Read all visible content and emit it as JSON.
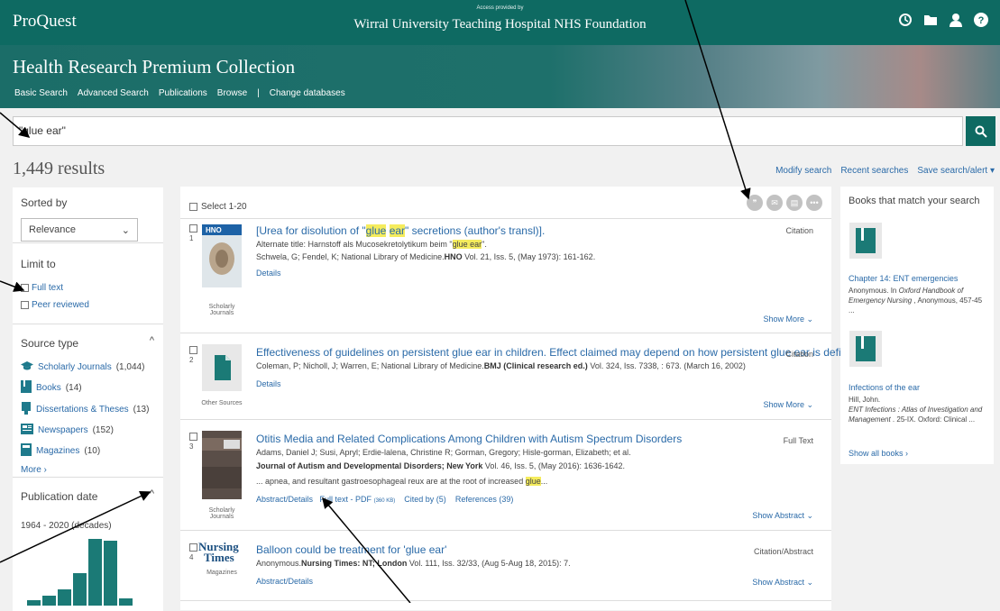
{
  "header": {
    "logo": "ProQuest",
    "access_label": "Access provided by",
    "access_org": "Wirral University Teaching Hospital NHS Foundation",
    "icons": [
      "history-icon",
      "folder-icon",
      "user-icon",
      "help-icon"
    ]
  },
  "banner": {
    "collection_title": "Health Research Premium Collection",
    "nav": [
      "Basic Search",
      "Advanced Search",
      "Publications",
      "Browse",
      "|",
      "Change databases"
    ]
  },
  "search": {
    "value": "\"glue ear\"",
    "button_icon": "search-icon"
  },
  "results_summary": {
    "count": "1,449 results",
    "links": [
      "Modify search",
      "Recent searches",
      "Save search/alert ▾"
    ]
  },
  "sidebar": {
    "sorted_by": "Sorted by",
    "sort_value": "Relevance",
    "limit_to": "Limit to",
    "limits": [
      "Full text",
      "Peer reviewed"
    ],
    "source_type": "Source type",
    "sources": [
      {
        "label": "Scholarly Journals",
        "count": "(1,044)"
      },
      {
        "label": "Books",
        "count": "(14)"
      },
      {
        "label": "Dissertations & Theses",
        "count": "(13)"
      },
      {
        "label": "Newspapers",
        "count": "(152)"
      },
      {
        "label": "Magazines",
        "count": "(10)"
      }
    ],
    "more": "More ›",
    "pub_date": "Publication date",
    "pub_range": "1964 - 2020 (decades)",
    "histogram": [
      0.08,
      0.14,
      0.24,
      0.47,
      0.98,
      0.95,
      0.1
    ]
  },
  "toolbar": {
    "select_all": "Select 1-20",
    "tools": [
      "cite-icon",
      "email-icon",
      "print-icon",
      "more-icon"
    ]
  },
  "records": [
    {
      "num": "1",
      "title_a": "[Urea for disolution of \"",
      "hl1": "glue",
      "hl2": "ear",
      "title_b": "\" secretions (author's transl)].",
      "alt_a": "Alternate title: Harnstoff als Mucosekretolytikum beim \"",
      "alt_hl": "glue ear",
      "alt_b": "\".",
      "authors": "Schwela, G; Fendel, K; National Library of Medicine.",
      "journal": "HNO",
      "source_rest": " Vol. 21, Iss. 5,  (May 1973): 161-162.",
      "details": "Details",
      "doc_type": "Citation",
      "ptype": "Scholarly Journals",
      "show": "Show More ⌄"
    },
    {
      "num": "2",
      "title": "Effectiveness of guidelines on persistent glue ear in children. Effect claimed may depend on how persistent glue ear is defined.",
      "authors": "Coleman, P; Nicholl, J; Warren, E; National Library of Medicine.",
      "journal": "BMJ (Clinical research ed.)",
      "source_rest": "  Vol. 324, Iss. 7338,  : 673. (March 16, 2002)",
      "details": "Details",
      "doc_type": "Citation",
      "ptype": "Other Sources",
      "show": "Show More ⌄"
    },
    {
      "num": "3",
      "title": "Otitis Media and Related Complications Among Children with Autism Spectrum Disorders",
      "authors": "Adams, Daniel J; Susi, Apryl; Erdie-lalena, Christine R; Gorman, Gregory; Hisle-gorman, Elizabeth; et al.",
      "journal": "Journal of Autism and Developmental Disorders; New York",
      "source_rest": " Vol. 46, Iss. 5,  (May 2016): 1636-1642.",
      "snippet_a": "... apnea, and resultant gastroesophageal reux are at the root of increased ",
      "snippet_hl": "glue",
      "snippet_b": "...",
      "links": [
        "Abstract/Details",
        "Full text - PDF",
        "(360 KB)",
        "Cited by (5)",
        "References (39)"
      ],
      "doc_type": "Full Text",
      "ptype": "Scholarly Journals",
      "show": "Show Abstract ⌄"
    },
    {
      "num": "4",
      "title": "Balloon could be treatment for 'glue ear'",
      "authors": "Anonymous.",
      "journal": "Nursing Times: NT; London",
      "source_rest": " Vol. 111, Iss. 32/33,  (Aug 5-Aug 18, 2015): 7.",
      "details": "Abstract/Details",
      "doc_type": "Citation/Abstract",
      "ptype": "Magazines",
      "logo_a": "Nursing",
      "logo_b": "Times",
      "show": "Show Abstract ⌄"
    }
  ],
  "right_panel": {
    "title": "Books that match your search",
    "books": [
      {
        "title": "Chapter 14: ENT emergencies",
        "meta_a": "Anonymous. In ",
        "meta_i": "Oxford Handbook of Emergency Nursing",
        "meta_b": " , Anonymous, 457-45 ..."
      },
      {
        "title": "Infections of the ear",
        "meta_a": "Hill, John.",
        "meta_i": "ENT Infections : Atlas of Investigation and Management",
        "meta_b": " . 25-IX. Oxford: Clinical ..."
      }
    ],
    "show_all": "Show all books ›"
  },
  "colors": {
    "brand": "#0e6a62",
    "link": "#2a6aa8",
    "highlight": "#f5ec5d"
  }
}
